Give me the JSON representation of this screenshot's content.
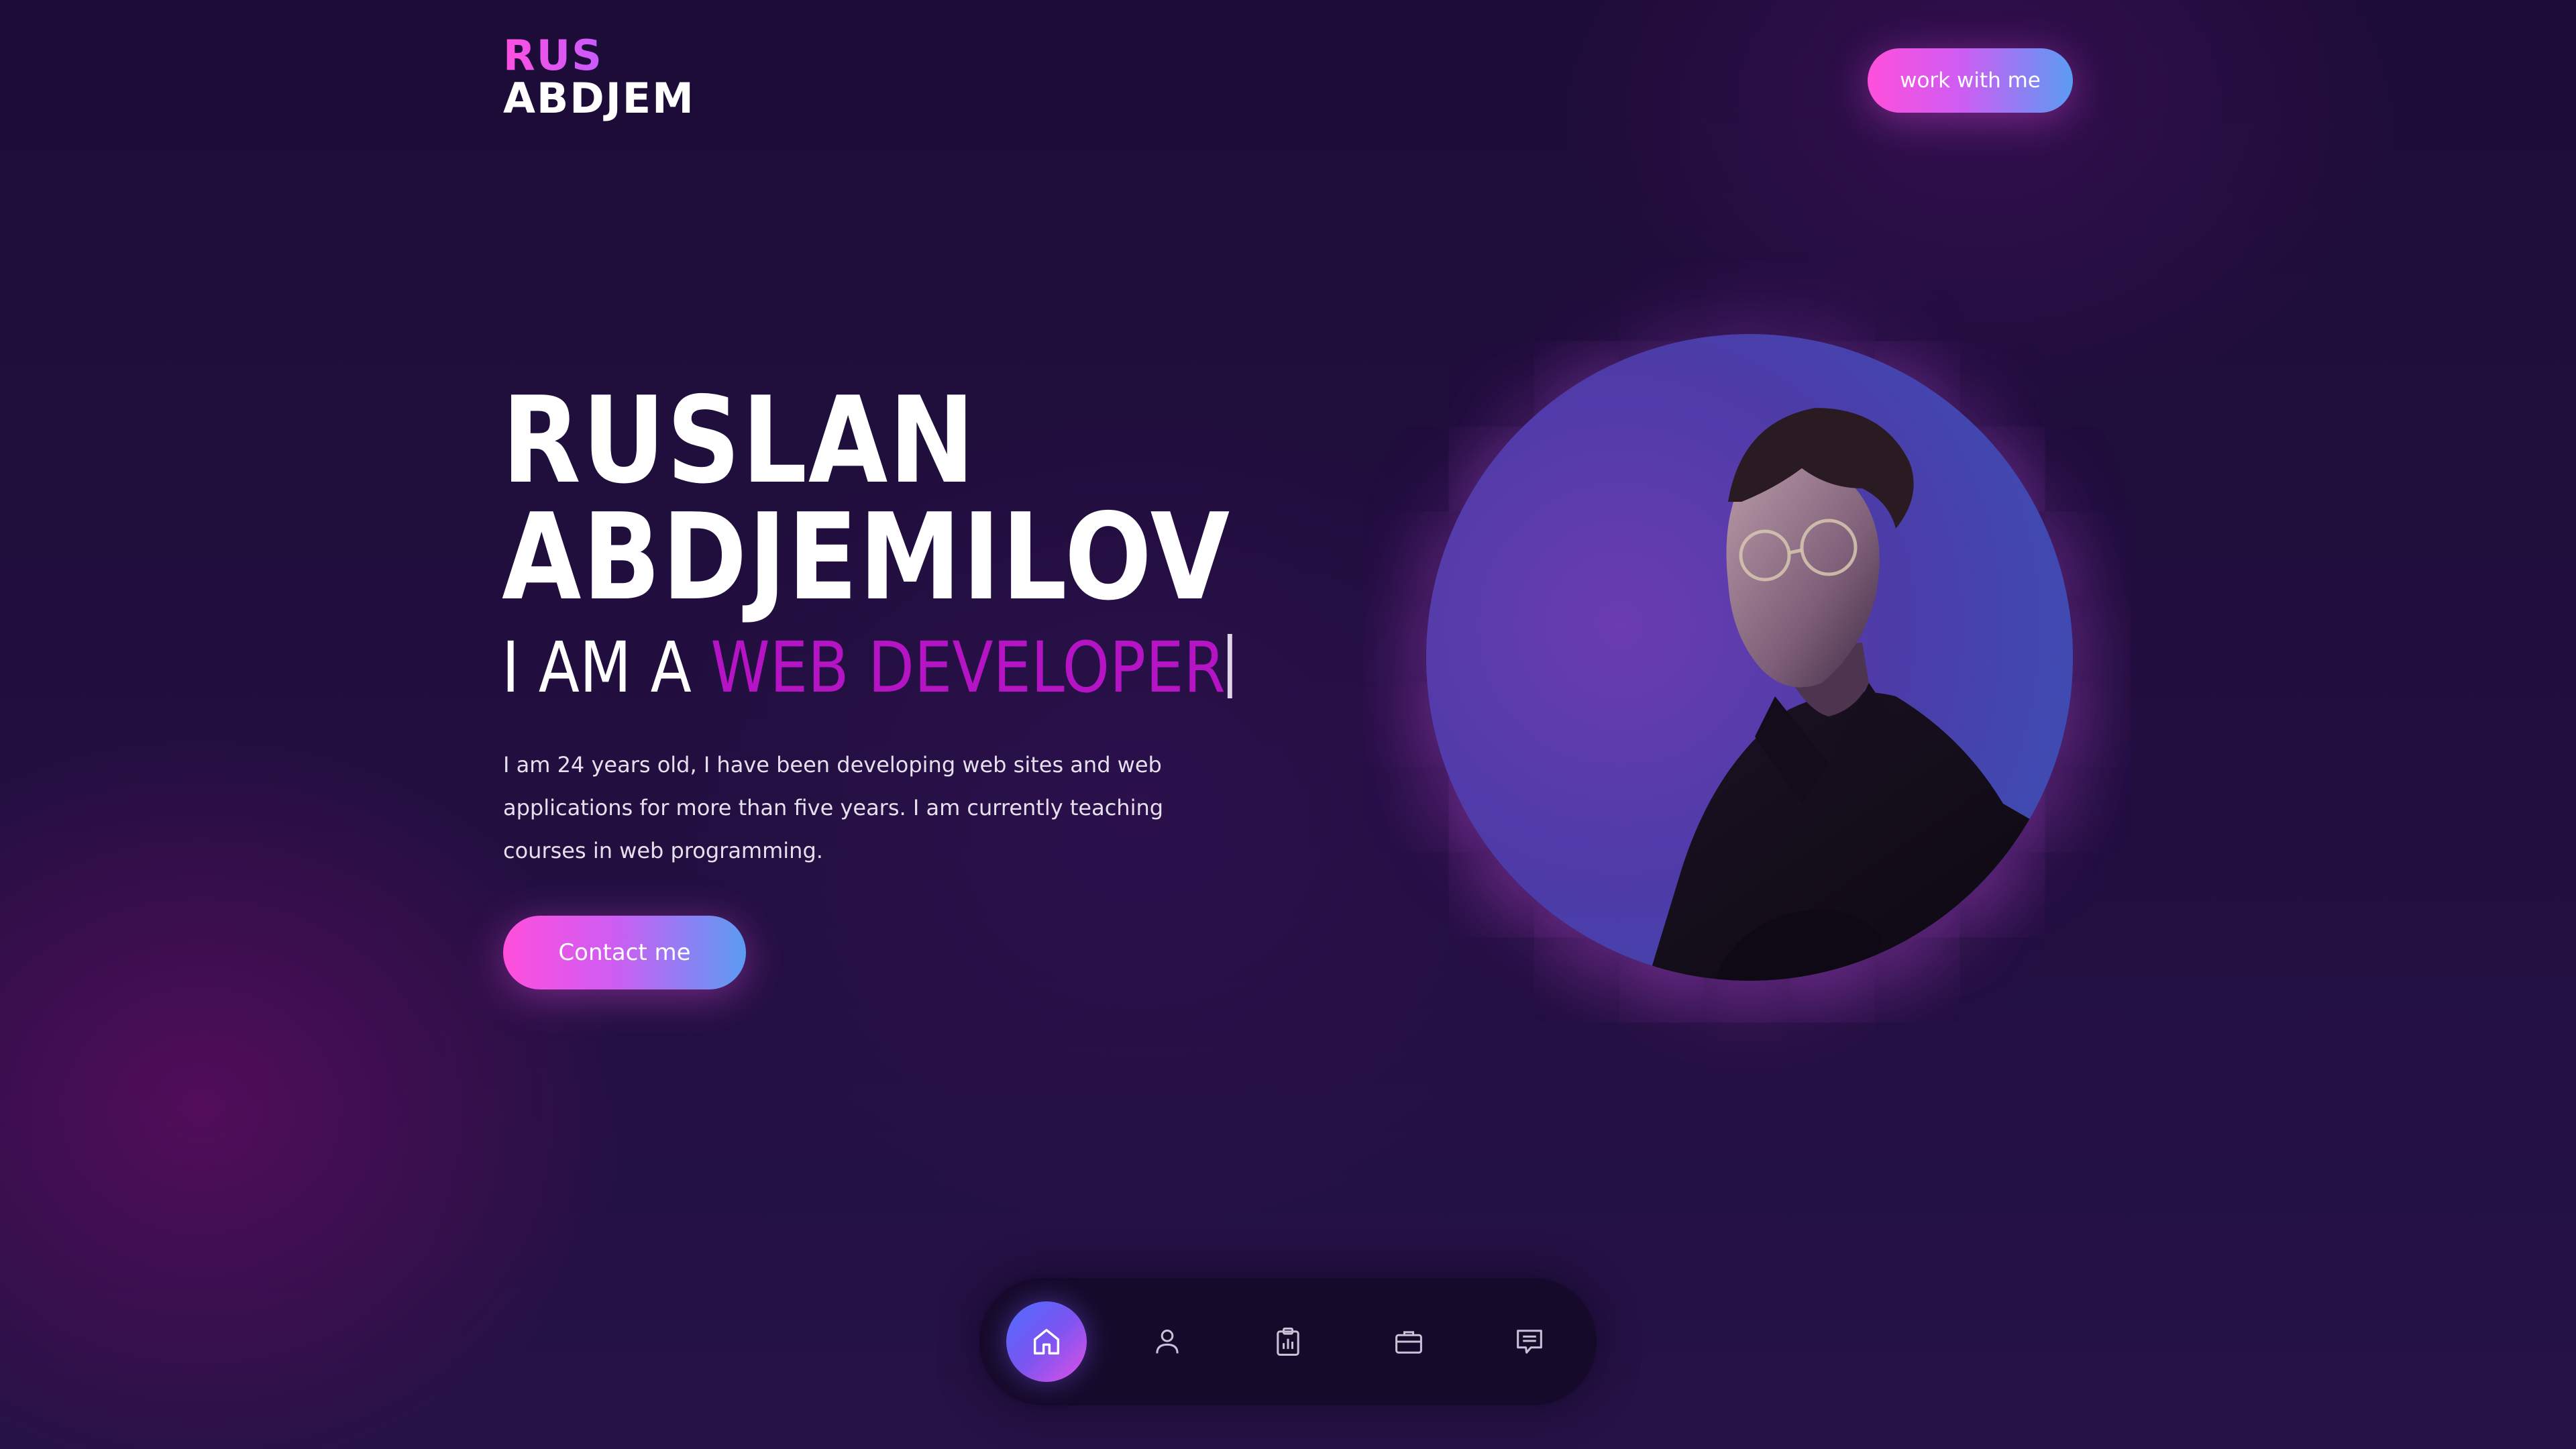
{
  "logo": {
    "line1": "RUS",
    "line2": "ABDJEM"
  },
  "header": {
    "cta_label": "work with me"
  },
  "hero": {
    "name_line1": "RUSLAN",
    "name_line2": "ABDJEMILOV",
    "role_prefix": "I AM A ",
    "role_highlight": "WEB DEVELOPER",
    "bio": "I am 24 years old, I have been developing web sites and web applications for more than five years. I am currently teaching courses in web programming.",
    "contact_label": "Contact me"
  },
  "nav": {
    "items": [
      {
        "icon": "home-icon",
        "active": true
      },
      {
        "icon": "user-icon",
        "active": false
      },
      {
        "icon": "clipboard-chart-icon",
        "active": false
      },
      {
        "icon": "briefcase-icon",
        "active": false
      },
      {
        "icon": "message-icon",
        "active": false
      }
    ]
  },
  "colors": {
    "background": "#1f0e3a",
    "accent_pink": "#ff4fdc",
    "accent_blue": "#5a9cf2",
    "highlight_text": "#b414c4",
    "nav_bar": "#160a2a"
  }
}
